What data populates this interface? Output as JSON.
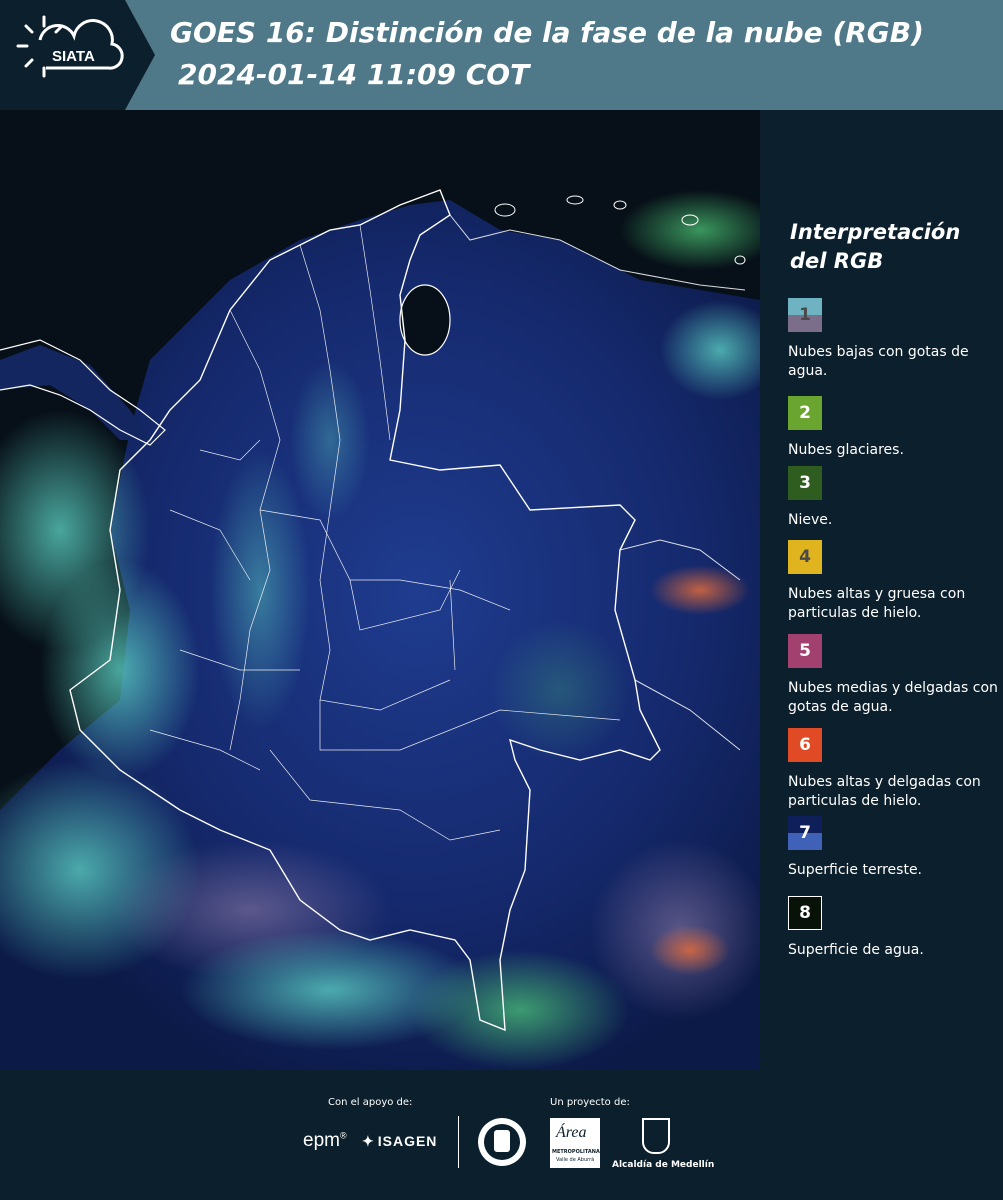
{
  "header": {
    "logo_text": "SIATA",
    "title_line1": "GOES 16: Distinción de la fase de la nube (RGB)",
    "title_line2": "2024-01-14 11:09 COT"
  },
  "legend": {
    "title_line1": "Interpretación",
    "title_line2": "del RGB",
    "items": [
      {
        "num": "1",
        "label": "Nubes bajas con gotas de agua.",
        "color_top": "#6fb3c3",
        "color_bottom": "#7a6e8a",
        "num_color": "#4a4a4a"
      },
      {
        "num": "2",
        "label": "Nubes glaciares.",
        "color_top": "#6aa62f",
        "color_bottom": "#6aa62f",
        "num_color": "#ffffff"
      },
      {
        "num": "3",
        "label": "Nieve.",
        "color_top": "#2f5d1f",
        "color_bottom": "#2f5d1f",
        "num_color": "#ffffff"
      },
      {
        "num": "4",
        "label": "Nubes altas y gruesa con particulas de hielo.",
        "color_top": "#e0b41e",
        "color_bottom": "#e0b41e",
        "num_color": "#4a4a4a"
      },
      {
        "num": "5",
        "label": "Nubes medias y delgadas con gotas de agua.",
        "color_top": "#a2406f",
        "color_bottom": "#a2406f",
        "num_color": "#ffffff"
      },
      {
        "num": "6",
        "label": "Nubes altas y delgadas con particulas de hielo.",
        "color_top": "#e04a24",
        "color_bottom": "#e04a24",
        "num_color": "#ffffff"
      },
      {
        "num": "7",
        "label": "Superficie terreste.",
        "color_top": "#0e1f5a",
        "color_bottom": "#3f62b8",
        "num_color": "#ffffff"
      },
      {
        "num": "8",
        "label": "Superficie de agua.",
        "color_top": "#081208",
        "color_bottom": "#081208",
        "num_color": "#ffffff"
      }
    ]
  },
  "footer": {
    "support_label": "Con el apoyo de:",
    "project_label": "Un proyecto de:",
    "sponsors": {
      "epm": "epm",
      "isagen": "ISAGEN",
      "area_top": "Área",
      "area_sub": "METROPOLITANA",
      "area_sub2": "Valle de Aburrá",
      "alcaldia": "Alcaldía de Medellín"
    }
  }
}
